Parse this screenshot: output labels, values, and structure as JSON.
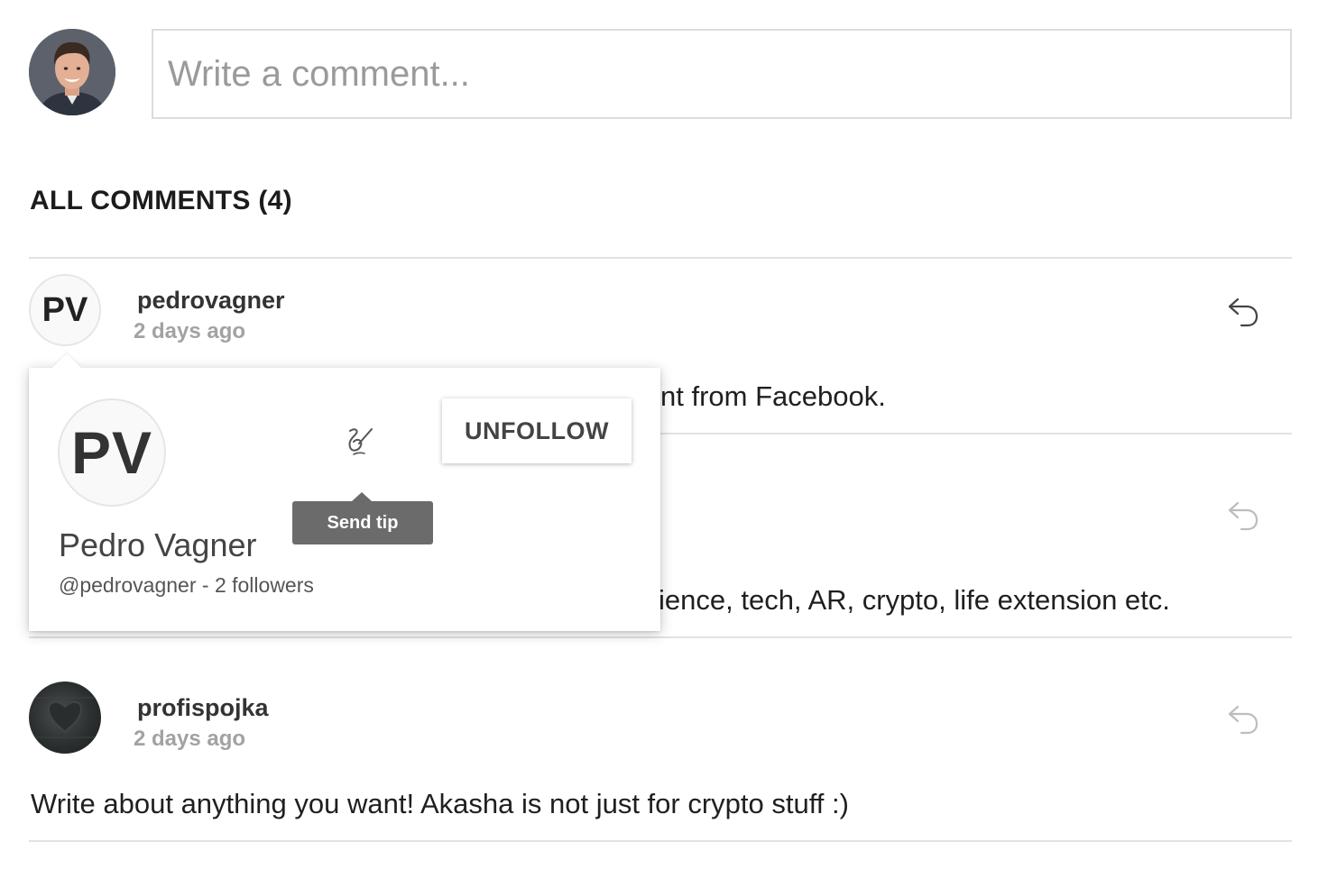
{
  "composer": {
    "placeholder": "Write a comment..."
  },
  "comments_header": "ALL COMMENTS (4)",
  "comments": [
    {
      "avatar_initials": "PV",
      "author": "pedrovagner",
      "time": "2 days ago",
      "visible_text": "nt from Facebook."
    },
    {
      "visible_text": "ience, tech, AR, crypto, life extension etc."
    },
    {
      "author": "profispojka",
      "time": "2 days ago",
      "text": "Write about anything you want! Akasha is not just for crypto stuff :)"
    }
  ],
  "profile_card": {
    "initials": "PV",
    "name": "Pedro Vagner",
    "handle_line": "@pedrovagner - 2 followers",
    "tip_tooltip": "Send tip",
    "unfollow_label": "UNFOLLOW"
  },
  "icons": {
    "reply": "reply-arrow-icon",
    "tip": "tip-signature-icon"
  }
}
